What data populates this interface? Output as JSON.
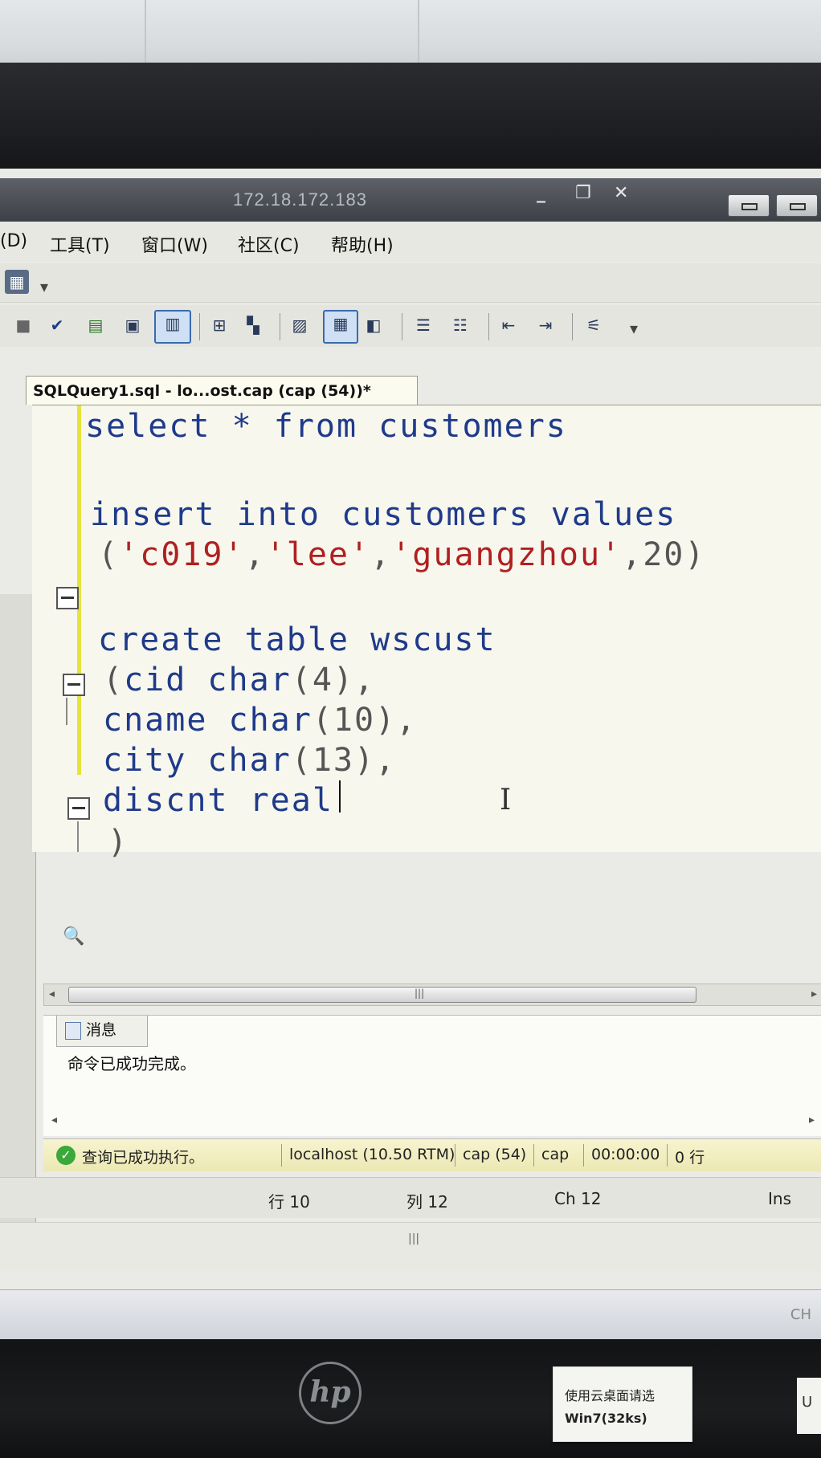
{
  "window": {
    "remote_host": "172.18.172.183",
    "controls": [
      "_",
      "❐",
      "✕"
    ]
  },
  "menu": {
    "items": [
      "(D)",
      "工具(T)",
      "窗口(W)",
      "社区(C)",
      "帮助(H)"
    ]
  },
  "document_tab": {
    "label": "SQLQuery1.sql - lo...ost.cap (cap (54))*"
  },
  "editor": {
    "lines": [
      {
        "segments": [
          {
            "t": "select * from customers",
            "k": "kw"
          }
        ]
      },
      {
        "segments": [
          {
            "t": "insert into customers values",
            "k": "kw"
          }
        ]
      },
      {
        "segments": [
          {
            "t": "(",
            "k": "gray"
          },
          {
            "t": "'c019'",
            "k": "str"
          },
          {
            "t": ",",
            "k": "gray"
          },
          {
            "t": "'lee'",
            "k": "str"
          },
          {
            "t": ",",
            "k": "gray"
          },
          {
            "t": "'guangzhou'",
            "k": "str"
          },
          {
            "t": ",20)",
            "k": "gray"
          }
        ]
      },
      {
        "segments": [
          {
            "t": "create table wscust",
            "k": "kw"
          }
        ]
      },
      {
        "segments": [
          {
            "t": "(",
            "k": "gray"
          },
          {
            "t": "cid char",
            "k": "kw"
          },
          {
            "t": "(4),",
            "k": "gray"
          }
        ]
      },
      {
        "segments": [
          {
            "t": "cname char",
            "k": "kw"
          },
          {
            "t": "(10),",
            "k": "gray"
          }
        ]
      },
      {
        "segments": [
          {
            "t": "city char",
            "k": "kw"
          },
          {
            "t": "(13),",
            "k": "gray"
          }
        ]
      },
      {
        "segments": [
          {
            "t": "discnt real",
            "k": "kw"
          }
        ]
      },
      {
        "segments": [
          {
            "t": ")",
            "k": "gray"
          }
        ]
      }
    ]
  },
  "messages": {
    "tab_label": "消息",
    "text": "命令已成功完成。"
  },
  "status": {
    "message": "查询已成功执行。",
    "server": "localhost (10.50 RTM)",
    "login": "cap (54)",
    "database": "cap",
    "elapsed": "00:00:00",
    "rows": "0 行"
  },
  "position": {
    "line": "行 10",
    "col": "列 12",
    "ch": "Ch 12",
    "mode": "Ins"
  },
  "sticker": {
    "line1": "使用云桌面请选",
    "line2": "Win7(32ks)"
  },
  "sticker2": {
    "text": "U"
  },
  "monitor_brand": "hp",
  "colors": {
    "keyword": "#1f3a8a",
    "string": "#b02020",
    "status_bar": "#f2efc4"
  }
}
